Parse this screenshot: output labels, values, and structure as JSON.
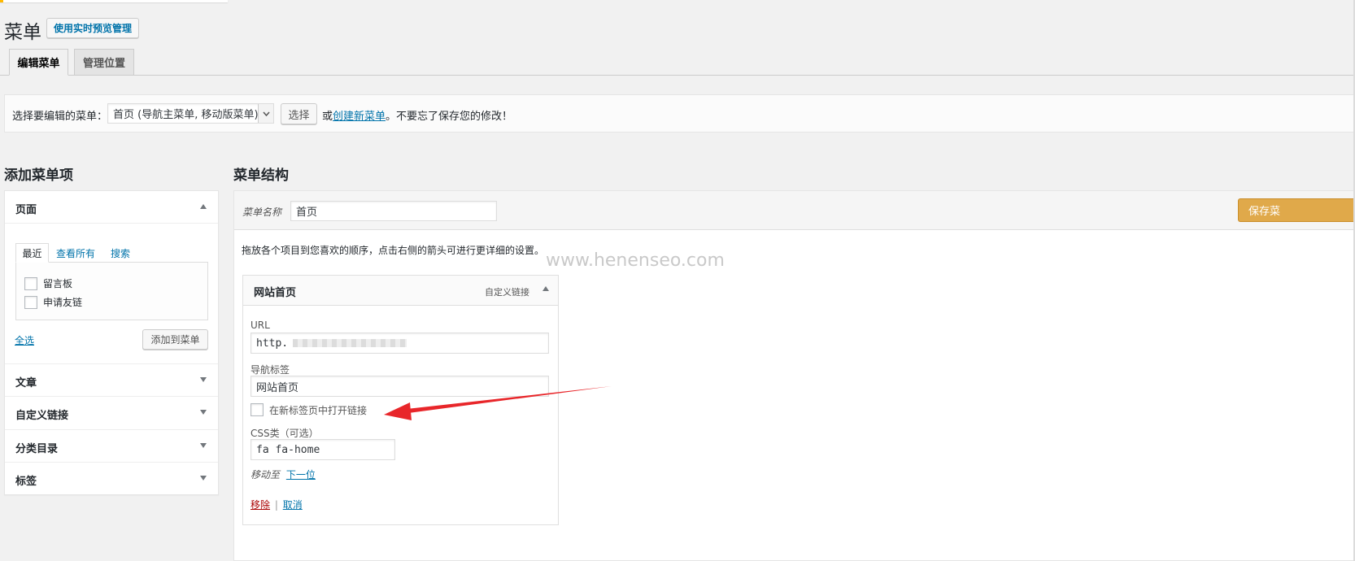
{
  "header": {
    "title": "菜单",
    "live_preview_button": "使用实时预览管理"
  },
  "tabs": [
    {
      "label": "编辑菜单",
      "active": true
    },
    {
      "label": "管理位置",
      "active": false
    }
  ],
  "select_bar": {
    "label": "选择要编辑的菜单：",
    "selected_menu": "首页 (导航主菜单, 移动版菜单)",
    "select_button": "选择",
    "or_text": "或",
    "create_link": "创建新菜单",
    "reminder": "。不要忘了保存您的修改！"
  },
  "left": {
    "heading": "添加菜单项",
    "pages_section": {
      "title": "页面",
      "tabs": [
        "最近",
        "查看所有",
        "搜索"
      ],
      "items": [
        "留言板",
        "申请友链"
      ],
      "select_all": "全选",
      "add_button": "添加到菜单"
    },
    "sections": [
      "文章",
      "自定义链接",
      "分类目录",
      "标签"
    ]
  },
  "right": {
    "heading": "菜单结构",
    "menu_name_label": "菜单名称",
    "menu_name_value": "首页",
    "save_button": "保存菜",
    "instructions": "拖放各个项目到您喜欢的顺序，点击右侧的箭头可进行更详细的设置。",
    "watermark": "www.henenseo.com",
    "item": {
      "title": "网站首页",
      "type": "自定义链接",
      "url_label": "URL",
      "url_value": "http.",
      "nav_label_label": "导航标签",
      "nav_label_value": "网站首页",
      "new_tab_label": "在新标签页中打开链接",
      "css_label": "CSS类（可选）",
      "css_value": "fa fa-home",
      "move_label": "移动至",
      "move_link": "下一位",
      "remove_link": "移除",
      "separator": "|",
      "cancel_link": "取消"
    }
  },
  "colors": {
    "accent": "#0073aa",
    "save_button": "#e0a94a",
    "annotation_arrow": "#e8262a",
    "remove_link": "#a00"
  }
}
